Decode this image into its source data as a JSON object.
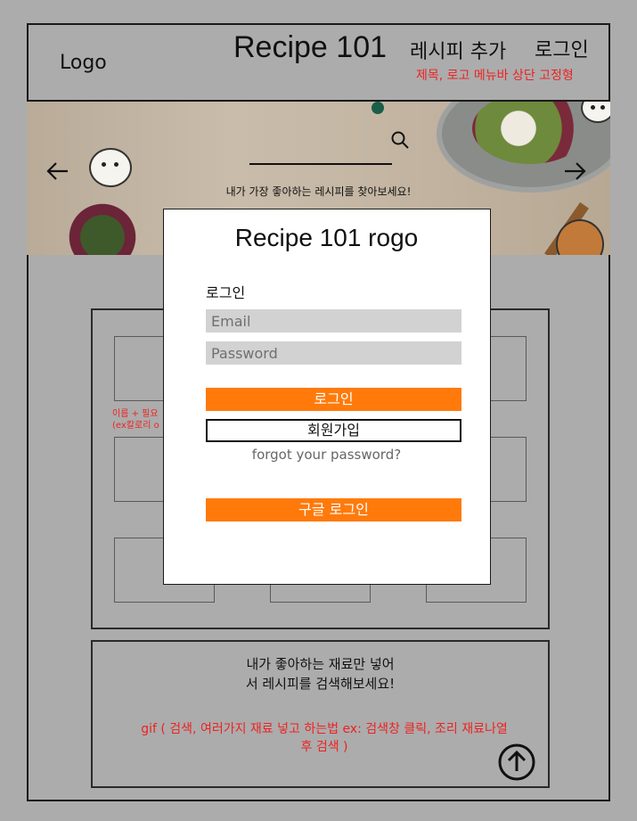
{
  "header": {
    "logo": "Logo",
    "title": "Recipe 101",
    "nav_add_recipe": "레시피 추가",
    "nav_login": "로그인",
    "note": "제목, 로고 메뉴바 상단 고정형"
  },
  "banner": {
    "tagline": "내가 가장 좋아하는 레시피를 찾아보세요!"
  },
  "grid": {
    "note_line1": "이름 + 필요",
    "note_line2": "(ex칼로리 o"
  },
  "bottom": {
    "title_line1": "내가 좋아하는 재료만 넣어",
    "title_line2": "서 레시피를 검색해보세요!",
    "note_line1": "gif ( 검색, 여러가지 재료 넣고 하는법 ex: 검색창 클릭, 조리 재료나열",
    "note_line2": "후 검색 )"
  },
  "modal": {
    "title": "Recipe 101 rogo",
    "login_label": "로그인",
    "email_placeholder": "Email",
    "password_placeholder": "Password",
    "login_button": "로그인",
    "signup_button": "회원가입",
    "forgot_link": "forgot your password?",
    "google_login_button": "구글 로그인"
  },
  "colors": {
    "background": "#acacac",
    "accent": "#ff7a0a",
    "note_red": "#ee2222"
  }
}
